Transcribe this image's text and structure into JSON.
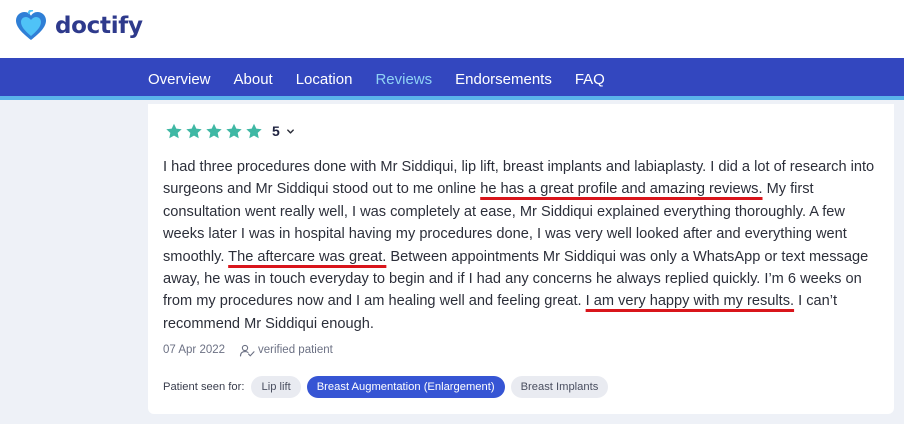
{
  "brand": {
    "name": "doctify",
    "logo_icon": "heart-logo-icon",
    "colors": {
      "logo_text": "#2e3a8c",
      "heart_dark": "#2f7fd6",
      "heart_light": "#4fc3f7"
    }
  },
  "nav": {
    "items": [
      {
        "label": "Overview",
        "active": false
      },
      {
        "label": "About",
        "active": false
      },
      {
        "label": "Location",
        "active": false
      },
      {
        "label": "Reviews",
        "active": true
      },
      {
        "label": "Endorsements",
        "active": false
      },
      {
        "label": "FAQ",
        "active": false
      }
    ],
    "colors": {
      "background": "#3347bf",
      "accent_line": "#5ab4ea",
      "active_text": "#8fd2f5"
    }
  },
  "review": {
    "rating": {
      "stars": 5,
      "max": 5,
      "value": "5",
      "star_color": "#3fb8a4",
      "chevron_icon": "chevron-down-icon"
    },
    "text": {
      "p1": "I had three procedures done with Mr Siddiqui, lip lift, breast implants and labiaplasty. I did a lot of research into surgeons and Mr Siddiqui stood out to me online ",
      "h1": "he has a great profile and amazing reviews.",
      "p2": " My first consultation went really well, I was completely at ease, Mr Siddiqui explained everything thoroughly. A few weeks later I was in hospital having my procedures done, I was very well looked after and everything went smoothly. ",
      "h2": "The aftercare was great.",
      "p3": " Between appointments Mr Siddiqui was only a WhatsApp or text message away, he was in touch everyday to begin and if I had any concerns he always replied quickly. I’m 6 weeks on from my procedures now and I am healing well and feeling great. ",
      "h3": "I am very happy with my results.",
      "p4": " I can’t recommend Mr Siddiqui enough.",
      "highlight_color": "#d9151b"
    },
    "date": "07 Apr 2022",
    "verified_label": "verified patient",
    "verified_icon": "verified-user-icon",
    "tags_label": "Patient seen for:",
    "tags": [
      {
        "label": "Lip lift",
        "active": false
      },
      {
        "label": "Breast Augmentation (Enlargement)",
        "active": true
      },
      {
        "label": "Breast Implants",
        "active": false
      }
    ],
    "tag_colors": {
      "active_bg": "#3655d4",
      "inactive_bg": "#e9ebf1"
    }
  }
}
